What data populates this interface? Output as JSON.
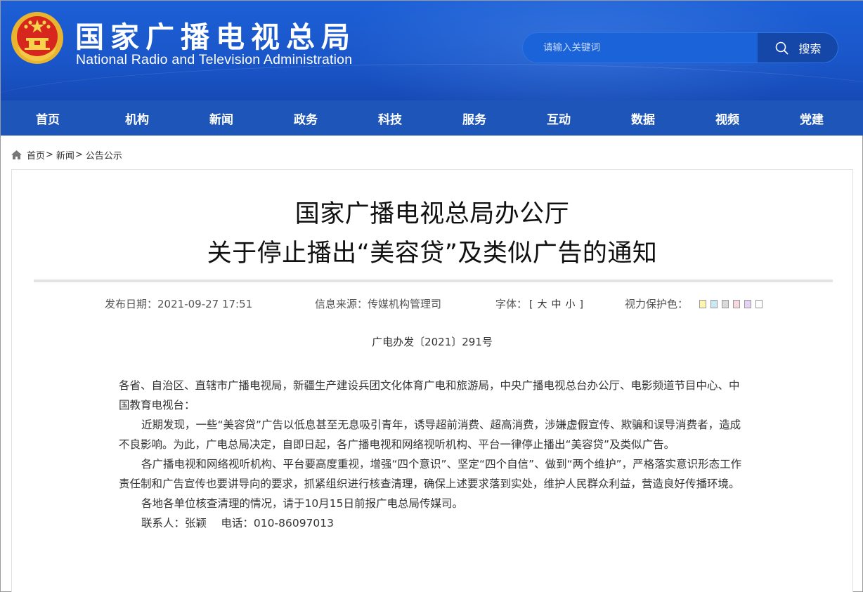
{
  "header": {
    "title_cn": "国家广播电视总局",
    "title_en": "National Radio and Television Administration",
    "emblem_icon": "national-emblem-icon",
    "colors": {
      "header_blue": "#1a56c9",
      "nav_blue": "#1e55b8",
      "search_button": "#1547a8"
    }
  },
  "search": {
    "placeholder": "请输入关键词",
    "button_label": "搜索",
    "icon": "search-icon"
  },
  "nav": {
    "items": [
      "首页",
      "机构",
      "新闻",
      "政务",
      "科技",
      "服务",
      "互动",
      "数据",
      "视频",
      "党建"
    ]
  },
  "breadcrumb": {
    "icon": "home-icon",
    "items": [
      "首页",
      "新闻",
      "公告公示"
    ],
    "separator": ">"
  },
  "article": {
    "title_line1": "国家广播电视总局办公厅",
    "title_line2": "关于停止播出“美容贷”及类似广告的通知",
    "meta": {
      "date_label": "发布日期：",
      "date_value": "2021-09-27 17:51",
      "source_label": "信息来源：",
      "source_value": "传媒机构管理司",
      "font_label": "字体：",
      "font_open": "[",
      "font_sizes": [
        "大",
        "中",
        "小"
      ],
      "font_close": "]",
      "eye_label": "视力保护色：",
      "eye_colors": [
        "#fbf5b1",
        "#cbe9f5",
        "#d9d9d9",
        "#f6d9df",
        "#e4d2f5",
        "#ffffff"
      ]
    },
    "doc_number": "广电办发〔2021〕291号",
    "paragraphs": [
      "各省、自治区、直辖市广播电视局，新疆生产建设兵团文化体育广电和旅游局，中央广播电视总台办公厅、电影频道节目中心、中国教育电视台：",
      "近期发现，一些“美容贷”广告以低息甚至无息吸引青年，诱导超前消费、超高消费，涉嫌虚假宣传、欺骗和误导消费者，造成不良影响。为此，广电总局决定，自即日起，各广播电视和网络视听机构、平台一律停止播出“美容贷”及类似广告。",
      "各广播电视和网络视听机构、平台要高度重视，增强“四个意识”、坚定“四个自信”、做到“两个维护”，严格落实意识形态工作责任制和广告宣传也要讲导向的要求，抓紧组织进行核查清理，确保上述要求落到实处，维护人民群众利益，营造良好传播环境。",
      "各地各单位核查清理的情况，请于10月15日前报广电总局传媒司。",
      "联系人：张颖　 电话：010-86097013"
    ]
  }
}
